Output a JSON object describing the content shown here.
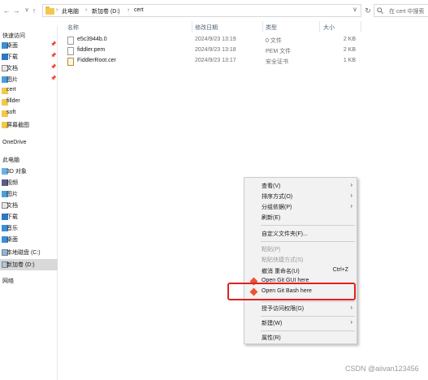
{
  "address": {
    "crumbs": [
      "此电脑",
      "新加卷 (D:)",
      "cert"
    ],
    "search_placeholder": "在 cert 中搜索"
  },
  "sidebar": {
    "quick_access": "快速访问",
    "quick_items": [
      {
        "label": "桌面",
        "icon": "desktop-icon",
        "pinned": true
      },
      {
        "label": "下载",
        "icon": "download-icon",
        "pinned": true
      },
      {
        "label": "文档",
        "icon": "document-icon",
        "pinned": true
      },
      {
        "label": "图片",
        "icon": "picture-icon",
        "pinned": true
      },
      {
        "label": "cert",
        "icon": "folder-icon",
        "pinned": false
      },
      {
        "label": "fillder",
        "icon": "folder-icon",
        "pinned": false
      },
      {
        "label": "soft",
        "icon": "folder-icon",
        "pinned": false
      },
      {
        "label": "屏幕截图",
        "icon": "folder-icon",
        "pinned": false
      }
    ],
    "onedrive": "OneDrive",
    "this_pc": "此电脑",
    "pc_items": [
      {
        "label": "3D 对象",
        "icon": "3d-objects-icon"
      },
      {
        "label": "视频",
        "icon": "video-icon"
      },
      {
        "label": "图片",
        "icon": "picture-icon"
      },
      {
        "label": "文档",
        "icon": "document-icon"
      },
      {
        "label": "下载",
        "icon": "download-icon"
      },
      {
        "label": "音乐",
        "icon": "music-icon"
      },
      {
        "label": "桌面",
        "icon": "desktop-icon"
      },
      {
        "label": "本地磁盘 (C:)",
        "icon": "drive-icon"
      },
      {
        "label": "新加卷 (D:)",
        "icon": "drive-icon"
      }
    ],
    "network": "网络"
  },
  "columns": {
    "name": "名称",
    "date": "修改日期",
    "type": "类型",
    "size": "大小"
  },
  "files": [
    {
      "name": "e5c3944b.0",
      "date": "2024/9/23 13:19",
      "type": "0 文件",
      "size": "2 KB",
      "icon": "file-icon"
    },
    {
      "name": "fiddler.pem",
      "date": "2024/9/23 13:18",
      "type": "PEM 文件",
      "size": "2 KB",
      "icon": "file-icon"
    },
    {
      "name": "FiddlerRoot.cer",
      "date": "2024/9/23 13:17",
      "type": "安全证书",
      "size": "1 KB",
      "icon": "certificate-icon"
    }
  ],
  "context_menu": {
    "items": [
      {
        "label": "查看(V)",
        "submenu": true
      },
      {
        "label": "排序方式(O)",
        "submenu": true
      },
      {
        "label": "分组依据(P)",
        "submenu": true
      },
      {
        "label": "刷新(E)"
      },
      {
        "label": "自定义文件夹(F)..."
      },
      {
        "label": "粘贴(P)",
        "disabled": true
      },
      {
        "label": "粘贴快捷方式(S)",
        "disabled": true
      },
      {
        "label": "撤消 重命名(U)",
        "shortcut": "Ctrl+Z"
      },
      {
        "label": "Open Git GUI here"
      },
      {
        "label": "Open Git Bash here"
      },
      {
        "label": "授予访问权限(G)",
        "submenu": true
      },
      {
        "label": "新建(W)",
        "submenu": true
      },
      {
        "label": "属性(R)"
      }
    ]
  },
  "watermark": "CSDN @aiivan123456",
  "colors": {
    "highlight": "#e0201e",
    "git": "#f05133",
    "folder": "#f3c74e"
  }
}
